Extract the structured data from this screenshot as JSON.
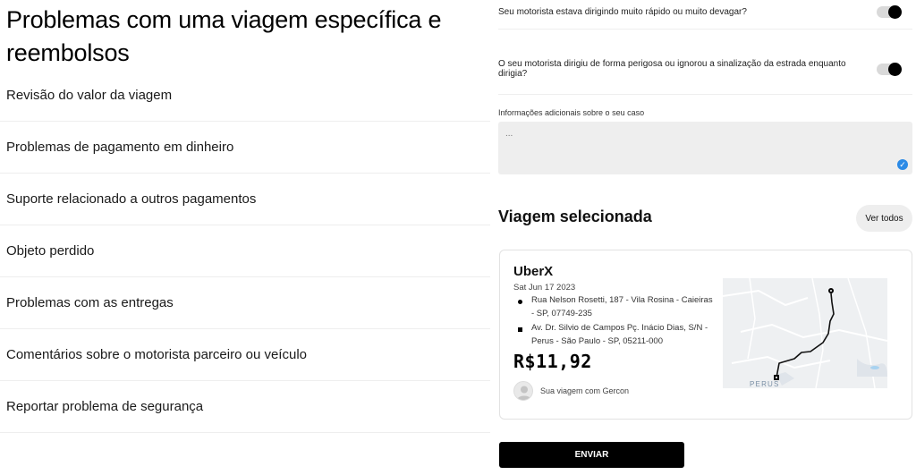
{
  "page": {
    "title": "Problemas com uma viagem específica e reembolsos"
  },
  "menu": {
    "items": [
      {
        "label": "Revisão do valor da viagem"
      },
      {
        "label": "Problemas de pagamento em dinheiro"
      },
      {
        "label": "Suporte relacionado a outros pagamentos"
      },
      {
        "label": "Objeto perdido"
      },
      {
        "label": "Problemas com as entregas"
      },
      {
        "label": "Comentários sobre o motorista parceiro ou veículo"
      },
      {
        "label": "Reportar problema de segurança"
      }
    ]
  },
  "form": {
    "questions": [
      {
        "label": "Seu motorista estava dirigindo muito rápido ou muito devagar?",
        "toggle": "on"
      },
      {
        "label": "O seu motorista dirigiu de forma perigosa ou ignorou a sinalização da estrada enquanto dirigia?",
        "toggle": "on"
      }
    ],
    "info_label": "Informações adicionais sobre o seu caso",
    "info_value": "",
    "info_placeholder": "..."
  },
  "trip": {
    "section_title": "Viagem selecionada",
    "see_all_label": "Ver todos",
    "product": "UberX",
    "date": "Sat Jun 17 2023",
    "pickup": "Rua Nelson Rosetti, 187 - Vila Rosina - Caieiras - SP, 07749-235",
    "dropoff": "Av. Dr. Silvio de Campos Pç. Inácio Dias, S/N - Perus - São Paulo - SP, 05211-000",
    "fare": "R$11,92",
    "driver_line": "Sua viagem com Gercon",
    "map_label": "PERUS"
  },
  "actions": {
    "submit_label": "ENVIAR"
  },
  "colors": {
    "accent": "#000000",
    "badge": "#2b8ae6",
    "input_bg": "#eeeeee"
  },
  "icons": {
    "pickup": "pickup-dot-icon",
    "dropoff": "dropoff-square-icon",
    "avatar": "user-avatar-icon",
    "check": "check-badge-icon"
  }
}
